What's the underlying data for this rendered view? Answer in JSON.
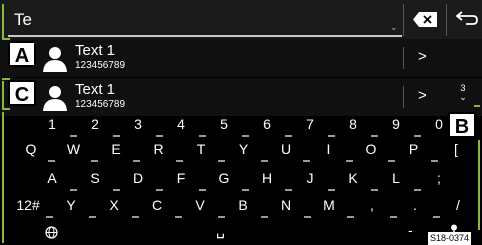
{
  "search": {
    "value": "Te"
  },
  "suggestions": [
    {
      "name": "Text 1",
      "number": "123456789",
      "callout": "A"
    },
    {
      "name": "Text 1",
      "number": "123456789",
      "callout": "C"
    }
  ],
  "scroll_indicator": "3",
  "arrow_glyph": ">",
  "keyboard": {
    "row_numbers": [
      "1",
      "2",
      "3",
      "4",
      "5",
      "6",
      "7",
      "8",
      "9",
      "0"
    ],
    "row_q": [
      "Q",
      "W",
      "E",
      "R",
      "T",
      "Y",
      "U",
      "I",
      "O",
      "P",
      "["
    ],
    "row_a": [
      "A",
      "S",
      "D",
      "F",
      "G",
      "H",
      "J",
      "K",
      "L",
      ";"
    ],
    "row_z": [
      "12#",
      "Y",
      "X",
      "C",
      "V",
      "B",
      "N",
      "M",
      ",",
      ".",
      "/"
    ],
    "space_glyph": "␣",
    "dash": "-"
  },
  "callout_b": "B",
  "figure_id": "S18-0374",
  "colors": {
    "accent": "#8ab83a"
  }
}
